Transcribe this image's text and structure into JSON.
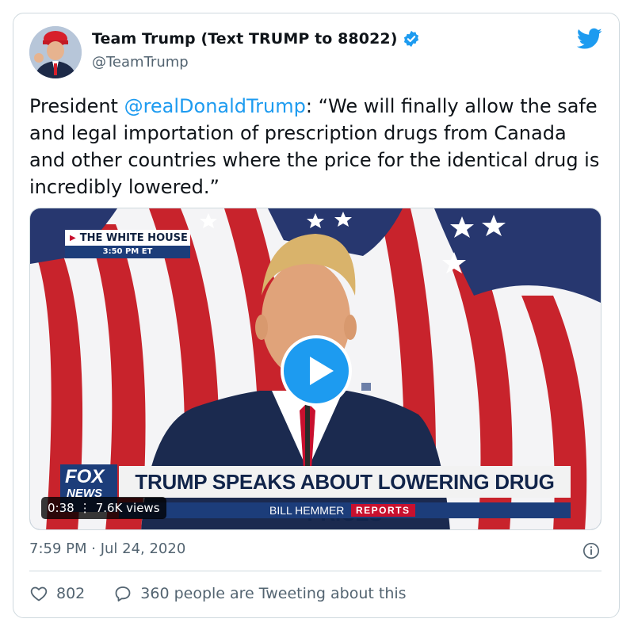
{
  "tweet": {
    "author": {
      "display_name": "Team Trump (Text TRUMP to 88022)",
      "handle": "@TeamTrump",
      "avatar_icon": "profile-photo"
    },
    "text_before": "President ",
    "mention": "@realDonaldTrump",
    "text_after": ": “We will finally allow the safe and legal importation of prescription drugs from Canada and other countries where the price for the identical drug is incredibly lowered.”",
    "video": {
      "broadcast_tag": "THE WHITE HOUSE",
      "broadcast_time": "3:50 PM ET",
      "network_logo_line1": "FOX",
      "network_logo_line2": "NEWS",
      "headline": "TRUMP SPEAKS ABOUT LOWERING DRUG PRICES",
      "anchor": "BILL HEMMER",
      "segment": "REPORTS",
      "duration": "0:38",
      "views": "7.6K views",
      "play_icon": "play-icon"
    },
    "timestamp": "7:59 PM · Jul 24, 2020",
    "likes": "802",
    "replies_text": "360 people are Tweeting about this"
  },
  "colors": {
    "accent": "#1d9bf0",
    "secondary_text": "#536471",
    "border": "#cfd9de"
  },
  "icons": [
    "verified-badge-icon",
    "twitter-bird-icon",
    "info-icon",
    "heart-icon",
    "reply-bubble-icon"
  ]
}
